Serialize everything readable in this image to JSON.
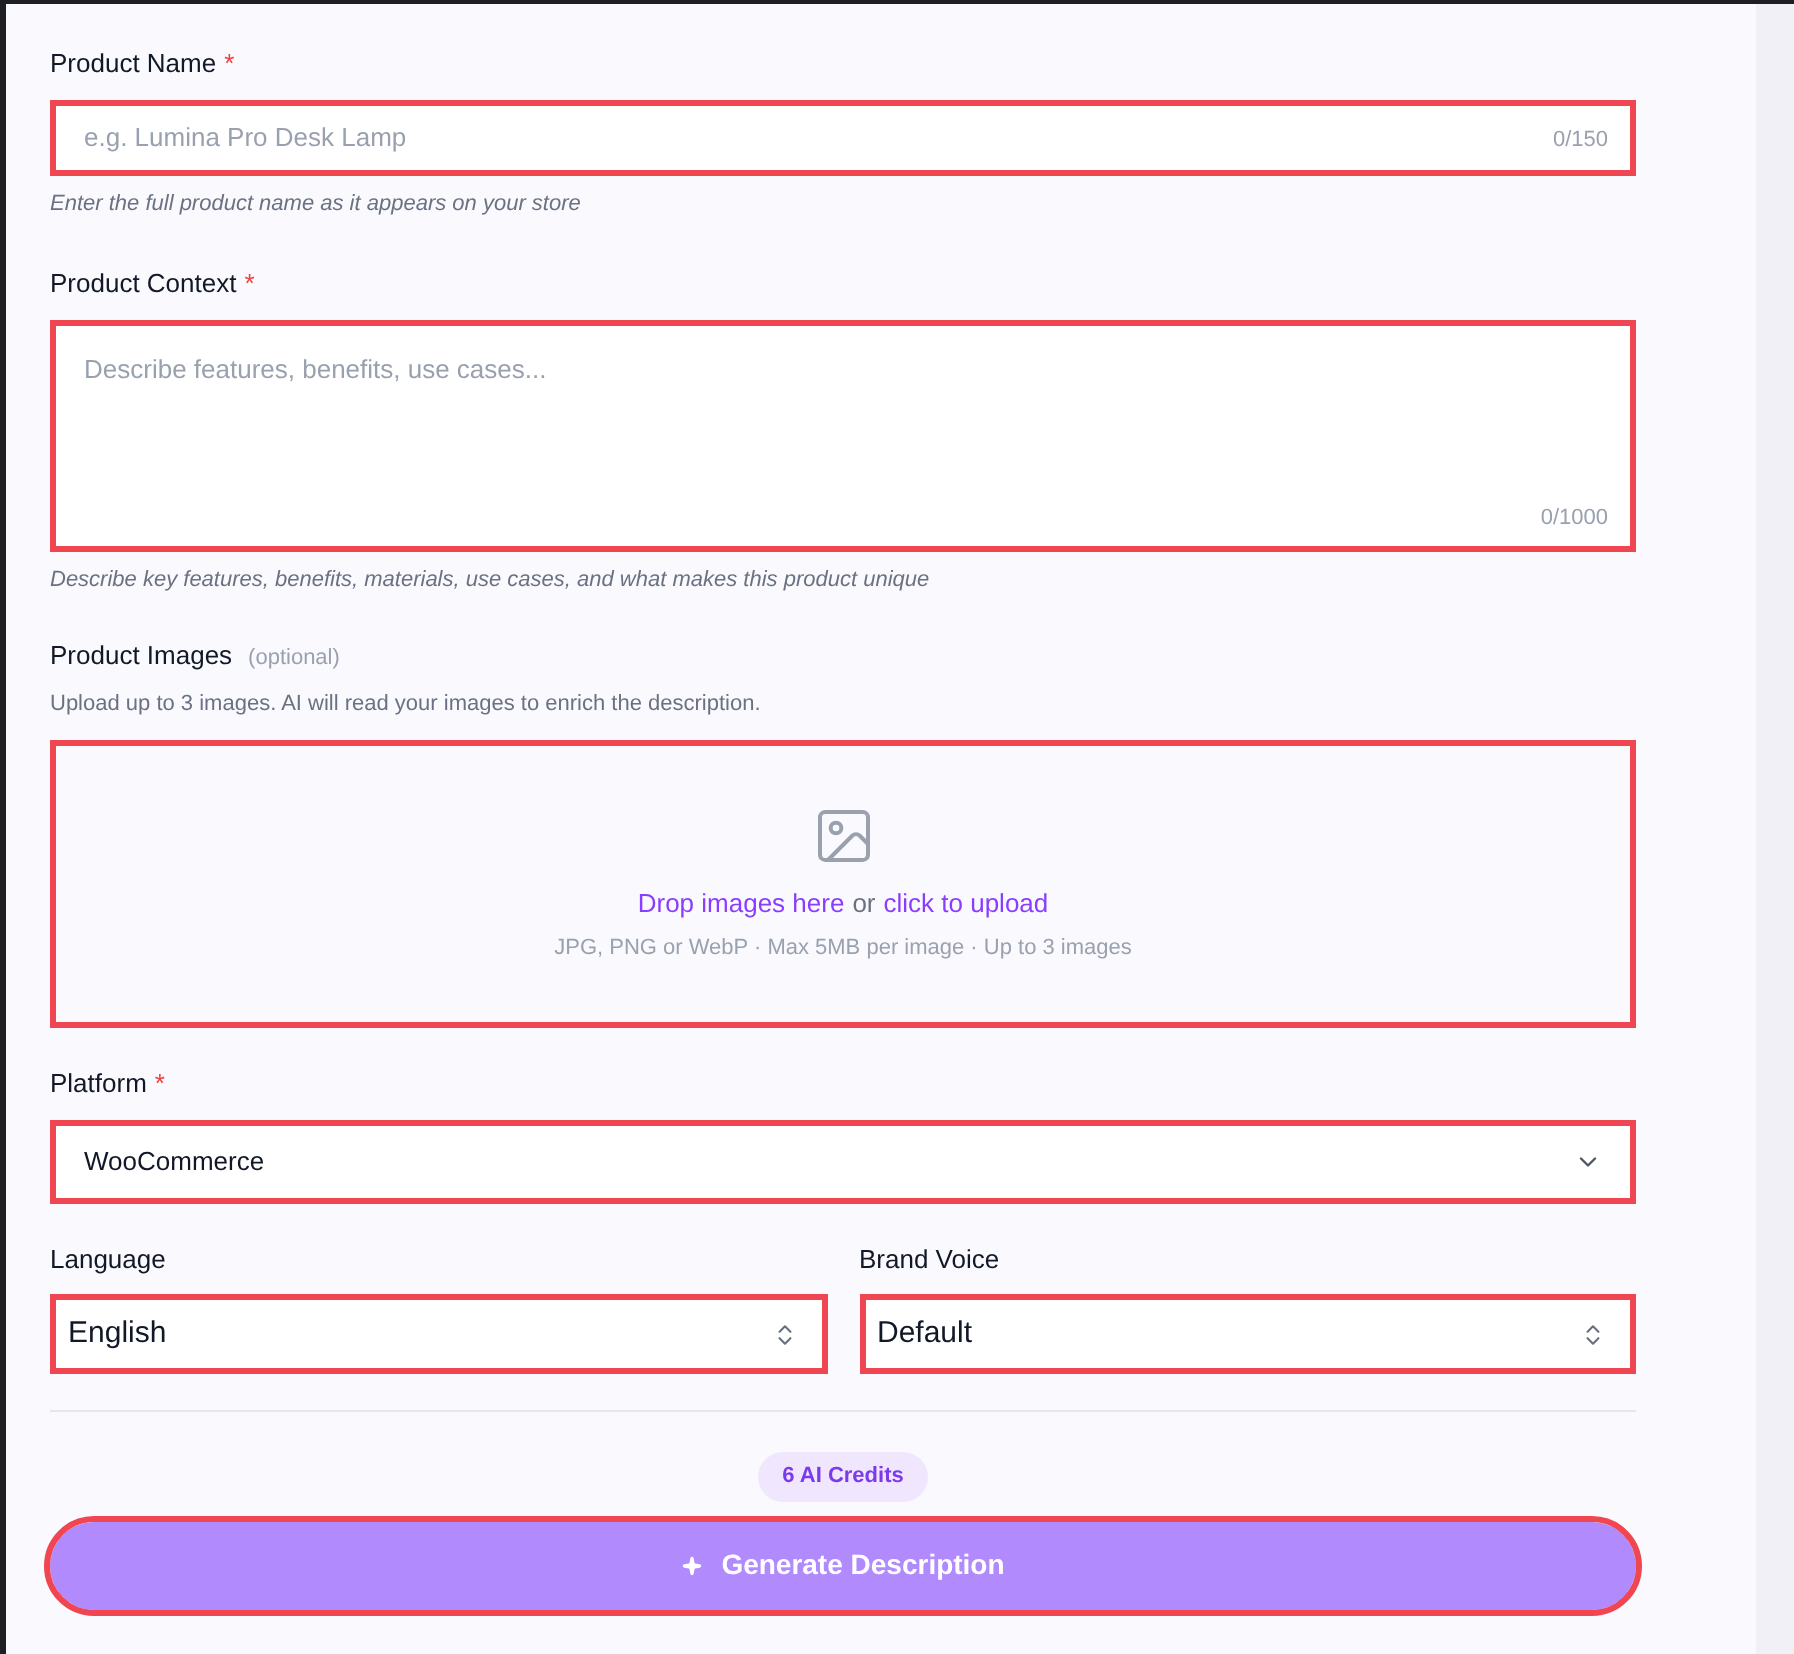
{
  "product_name": {
    "label": "Product Name",
    "required_mark": "*",
    "placeholder": "e.g. Lumina Pro Desk Lamp",
    "counter": "0/150",
    "highlighted": true,
    "hint": "Enter the full product name as it appears on your store"
  },
  "product_context": {
    "label": "Product Context",
    "required_mark": "*",
    "placeholder": "Describe features, benefits, use cases...",
    "counter": "0/1000",
    "highlighted": true,
    "hint": "Describe key features, benefits, materials, use cases, and what makes this product unique"
  },
  "product_images": {
    "label": "Product Images",
    "optional_tag": "(optional)",
    "description": "Upload up to 3 images. AI will read your images to enrich the description.",
    "drop_link": "Drop images here",
    "separator": "or",
    "upload_link": "click to upload",
    "formats": "JPG, PNG or WebP · Max 5MB per image · Up to 3 images",
    "highlighted": true
  },
  "platform": {
    "label": "Platform",
    "required_mark": "*",
    "value": "WooCommerce",
    "highlighted": true
  },
  "selects": [
    {
      "label": "Language",
      "value": "English",
      "highlighted": true
    },
    {
      "label": "Brand Voice",
      "value": "Default",
      "highlighted": true
    }
  ],
  "credits_badge": "6 AI Credits",
  "generate_button": {
    "label": "Generate Description",
    "highlighted": true,
    "disabled": true
  }
}
